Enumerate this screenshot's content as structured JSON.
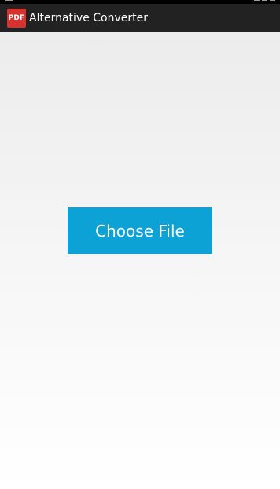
{
  "action_bar": {
    "icon_text": "PDF",
    "title": "Alternative Converter"
  },
  "main": {
    "choose_file_label": "Choose File"
  },
  "colors": {
    "action_bar_bg": "#222222",
    "icon_bg": "#d9322e",
    "button_bg": "#0ca2d6"
  }
}
